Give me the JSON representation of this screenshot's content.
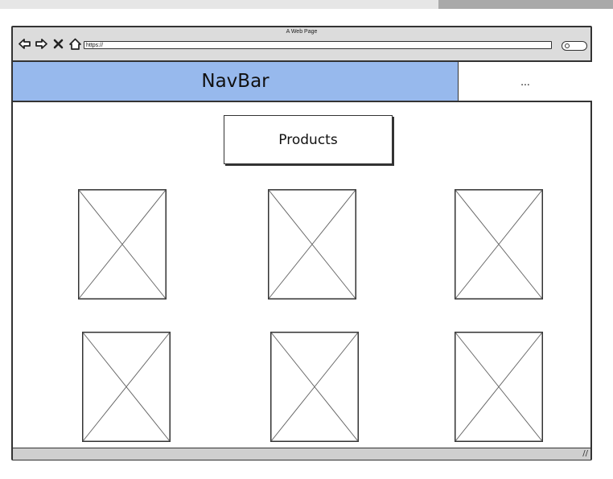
{
  "browser": {
    "page_title": "A Web Page",
    "url": "https://"
  },
  "navbar": {
    "label": "NavBar",
    "more_label": "..."
  },
  "main": {
    "products_button": "Products",
    "product_images": [
      {
        "icon": "image-placeholder-icon"
      },
      {
        "icon": "image-placeholder-icon"
      },
      {
        "icon": "image-placeholder-icon"
      },
      {
        "icon": "image-placeholder-icon"
      },
      {
        "icon": "image-placeholder-icon"
      },
      {
        "icon": "image-placeholder-icon"
      }
    ]
  },
  "colors": {
    "navbar_bg": "#97b9ed",
    "chrome_bg": "#dcdcdc",
    "outline": "#333333"
  }
}
